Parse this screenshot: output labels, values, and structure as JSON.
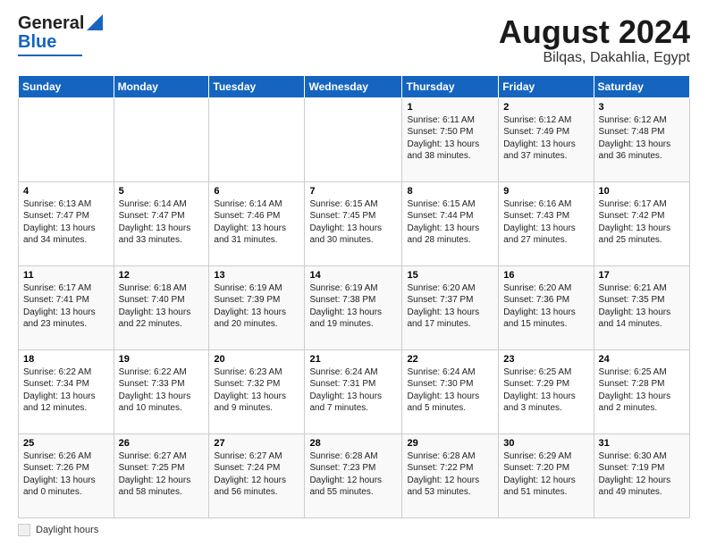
{
  "header": {
    "logo_general": "General",
    "logo_blue": "Blue",
    "title": "August 2024",
    "subtitle": "Bilqas, Dakahlia, Egypt"
  },
  "weekdays": [
    "Sunday",
    "Monday",
    "Tuesday",
    "Wednesday",
    "Thursday",
    "Friday",
    "Saturday"
  ],
  "weeks": [
    [
      {
        "day": "",
        "sunrise": "",
        "sunset": "",
        "daylight": ""
      },
      {
        "day": "",
        "sunrise": "",
        "sunset": "",
        "daylight": ""
      },
      {
        "day": "",
        "sunrise": "",
        "sunset": "",
        "daylight": ""
      },
      {
        "day": "",
        "sunrise": "",
        "sunset": "",
        "daylight": ""
      },
      {
        "day": "1",
        "sunrise": "Sunrise: 6:11 AM",
        "sunset": "Sunset: 7:50 PM",
        "daylight": "Daylight: 13 hours and 38 minutes."
      },
      {
        "day": "2",
        "sunrise": "Sunrise: 6:12 AM",
        "sunset": "Sunset: 7:49 PM",
        "daylight": "Daylight: 13 hours and 37 minutes."
      },
      {
        "day": "3",
        "sunrise": "Sunrise: 6:12 AM",
        "sunset": "Sunset: 7:48 PM",
        "daylight": "Daylight: 13 hours and 36 minutes."
      }
    ],
    [
      {
        "day": "4",
        "sunrise": "Sunrise: 6:13 AM",
        "sunset": "Sunset: 7:47 PM",
        "daylight": "Daylight: 13 hours and 34 minutes."
      },
      {
        "day": "5",
        "sunrise": "Sunrise: 6:14 AM",
        "sunset": "Sunset: 7:47 PM",
        "daylight": "Daylight: 13 hours and 33 minutes."
      },
      {
        "day": "6",
        "sunrise": "Sunrise: 6:14 AM",
        "sunset": "Sunset: 7:46 PM",
        "daylight": "Daylight: 13 hours and 31 minutes."
      },
      {
        "day": "7",
        "sunrise": "Sunrise: 6:15 AM",
        "sunset": "Sunset: 7:45 PM",
        "daylight": "Daylight: 13 hours and 30 minutes."
      },
      {
        "day": "8",
        "sunrise": "Sunrise: 6:15 AM",
        "sunset": "Sunset: 7:44 PM",
        "daylight": "Daylight: 13 hours and 28 minutes."
      },
      {
        "day": "9",
        "sunrise": "Sunrise: 6:16 AM",
        "sunset": "Sunset: 7:43 PM",
        "daylight": "Daylight: 13 hours and 27 minutes."
      },
      {
        "day": "10",
        "sunrise": "Sunrise: 6:17 AM",
        "sunset": "Sunset: 7:42 PM",
        "daylight": "Daylight: 13 hours and 25 minutes."
      }
    ],
    [
      {
        "day": "11",
        "sunrise": "Sunrise: 6:17 AM",
        "sunset": "Sunset: 7:41 PM",
        "daylight": "Daylight: 13 hours and 23 minutes."
      },
      {
        "day": "12",
        "sunrise": "Sunrise: 6:18 AM",
        "sunset": "Sunset: 7:40 PM",
        "daylight": "Daylight: 13 hours and 22 minutes."
      },
      {
        "day": "13",
        "sunrise": "Sunrise: 6:19 AM",
        "sunset": "Sunset: 7:39 PM",
        "daylight": "Daylight: 13 hours and 20 minutes."
      },
      {
        "day": "14",
        "sunrise": "Sunrise: 6:19 AM",
        "sunset": "Sunset: 7:38 PM",
        "daylight": "Daylight: 13 hours and 19 minutes."
      },
      {
        "day": "15",
        "sunrise": "Sunrise: 6:20 AM",
        "sunset": "Sunset: 7:37 PM",
        "daylight": "Daylight: 13 hours and 17 minutes."
      },
      {
        "day": "16",
        "sunrise": "Sunrise: 6:20 AM",
        "sunset": "Sunset: 7:36 PM",
        "daylight": "Daylight: 13 hours and 15 minutes."
      },
      {
        "day": "17",
        "sunrise": "Sunrise: 6:21 AM",
        "sunset": "Sunset: 7:35 PM",
        "daylight": "Daylight: 13 hours and 14 minutes."
      }
    ],
    [
      {
        "day": "18",
        "sunrise": "Sunrise: 6:22 AM",
        "sunset": "Sunset: 7:34 PM",
        "daylight": "Daylight: 13 hours and 12 minutes."
      },
      {
        "day": "19",
        "sunrise": "Sunrise: 6:22 AM",
        "sunset": "Sunset: 7:33 PM",
        "daylight": "Daylight: 13 hours and 10 minutes."
      },
      {
        "day": "20",
        "sunrise": "Sunrise: 6:23 AM",
        "sunset": "Sunset: 7:32 PM",
        "daylight": "Daylight: 13 hours and 9 minutes."
      },
      {
        "day": "21",
        "sunrise": "Sunrise: 6:24 AM",
        "sunset": "Sunset: 7:31 PM",
        "daylight": "Daylight: 13 hours and 7 minutes."
      },
      {
        "day": "22",
        "sunrise": "Sunrise: 6:24 AM",
        "sunset": "Sunset: 7:30 PM",
        "daylight": "Daylight: 13 hours and 5 minutes."
      },
      {
        "day": "23",
        "sunrise": "Sunrise: 6:25 AM",
        "sunset": "Sunset: 7:29 PM",
        "daylight": "Daylight: 13 hours and 3 minutes."
      },
      {
        "day": "24",
        "sunrise": "Sunrise: 6:25 AM",
        "sunset": "Sunset: 7:28 PM",
        "daylight": "Daylight: 13 hours and 2 minutes."
      }
    ],
    [
      {
        "day": "25",
        "sunrise": "Sunrise: 6:26 AM",
        "sunset": "Sunset: 7:26 PM",
        "daylight": "Daylight: 13 hours and 0 minutes."
      },
      {
        "day": "26",
        "sunrise": "Sunrise: 6:27 AM",
        "sunset": "Sunset: 7:25 PM",
        "daylight": "Daylight: 12 hours and 58 minutes."
      },
      {
        "day": "27",
        "sunrise": "Sunrise: 6:27 AM",
        "sunset": "Sunset: 7:24 PM",
        "daylight": "Daylight: 12 hours and 56 minutes."
      },
      {
        "day": "28",
        "sunrise": "Sunrise: 6:28 AM",
        "sunset": "Sunset: 7:23 PM",
        "daylight": "Daylight: 12 hours and 55 minutes."
      },
      {
        "day": "29",
        "sunrise": "Sunrise: 6:28 AM",
        "sunset": "Sunset: 7:22 PM",
        "daylight": "Daylight: 12 hours and 53 minutes."
      },
      {
        "day": "30",
        "sunrise": "Sunrise: 6:29 AM",
        "sunset": "Sunset: 7:20 PM",
        "daylight": "Daylight: 12 hours and 51 minutes."
      },
      {
        "day": "31",
        "sunrise": "Sunrise: 6:30 AM",
        "sunset": "Sunset: 7:19 PM",
        "daylight": "Daylight: 12 hours and 49 minutes."
      }
    ]
  ],
  "footer": {
    "box_label": "Daylight hours"
  }
}
